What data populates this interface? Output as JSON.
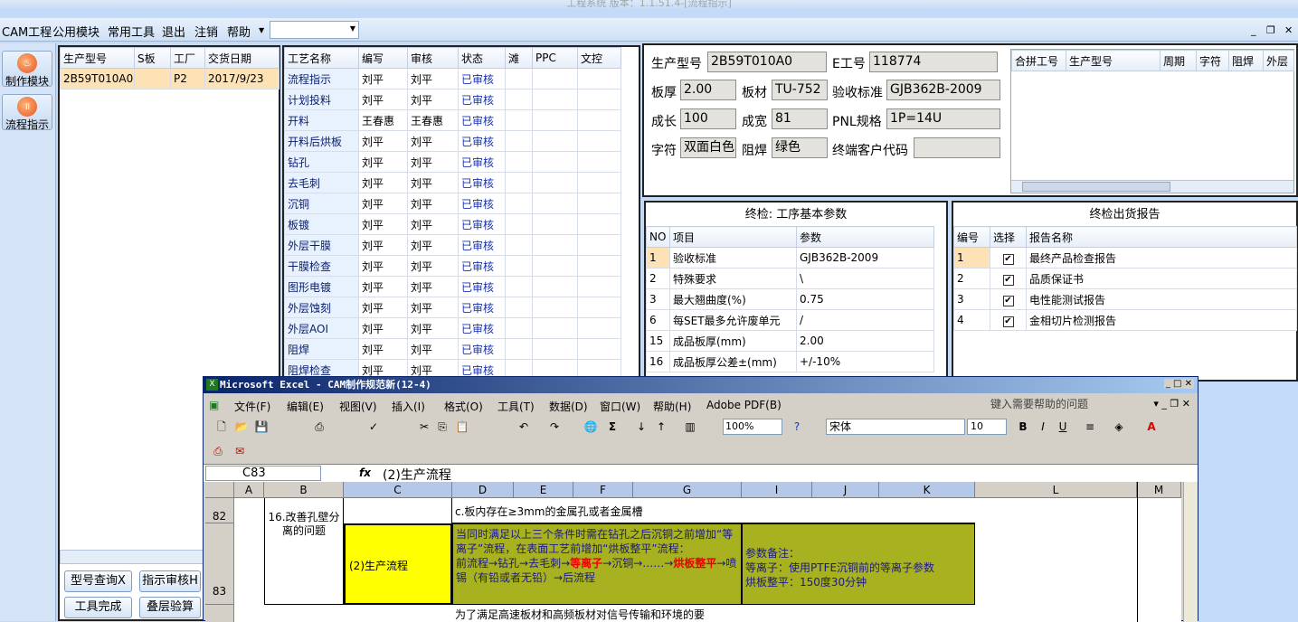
{
  "app": {
    "title": "工程系统 版本：1.1.51.4-[流程指示]"
  },
  "menu": [
    "CAM工程",
    "公用模块",
    "常用工具",
    "退出",
    "注销",
    "帮助"
  ],
  "nav": [
    {
      "label": "制作模块",
      "icon": "flame-icon"
    },
    {
      "label": "流程指示",
      "icon": "pause-icon"
    }
  ],
  "orders": {
    "headers": [
      "生产型号",
      "S板",
      "工厂",
      "交货日期"
    ],
    "rows": [
      [
        "2B59T010A0",
        "",
        "P2",
        "2017/9/23"
      ]
    ]
  },
  "process": {
    "headers": [
      "工艺名称",
      "编写",
      "审核",
      "状态",
      "滩",
      "PPC",
      "文控"
    ],
    "rows": [
      [
        "流程指示",
        "刘平",
        "刘平",
        "已审核"
      ],
      [
        "计划投料",
        "刘平",
        "刘平",
        "已审核"
      ],
      [
        "开料",
        "王春惠",
        "王春惠",
        "已审核"
      ],
      [
        "开料后烘板",
        "刘平",
        "刘平",
        "已审核"
      ],
      [
        "钻孔",
        "刘平",
        "刘平",
        "已审核"
      ],
      [
        "去毛刺",
        "刘平",
        "刘平",
        "已审核"
      ],
      [
        "沉铜",
        "刘平",
        "刘平",
        "已审核"
      ],
      [
        "板镀",
        "刘平",
        "刘平",
        "已审核"
      ],
      [
        "外层干膜",
        "刘平",
        "刘平",
        "已审核"
      ],
      [
        "干膜检查",
        "刘平",
        "刘平",
        "已审核"
      ],
      [
        "图形电镀",
        "刘平",
        "刘平",
        "已审核"
      ],
      [
        "外层蚀刻",
        "刘平",
        "刘平",
        "已审核"
      ],
      [
        "外层AOI",
        "刘平",
        "刘平",
        "已审核"
      ],
      [
        "阻焊",
        "刘平",
        "刘平",
        "已审核"
      ],
      [
        "阻焊检查",
        "刘平",
        "刘平",
        "已审核"
      ]
    ]
  },
  "info": {
    "l_model": "生产型号",
    "model": "2B59T010A0",
    "l_eno": "E工号",
    "eno": "118774",
    "l_thick": "板厚",
    "thick": "2.00",
    "l_mat": "板材",
    "mat": "TU-752",
    "l_std": "验收标准",
    "std": "GJB362B-2009",
    "l_len": "成长",
    "len": "100",
    "l_wid": "成宽",
    "wid": "81",
    "l_pnl": "PNL规格",
    "pnl": "1P=14U",
    "l_char": "字符",
    "char": "双面白色",
    "l_mask": "阻焊",
    "mask": "绿色",
    "l_cust": "终端客户代码",
    "cust": ""
  },
  "combine": {
    "headers": [
      "合拼工号",
      "生产型号",
      "周期",
      "字符",
      "阻焊",
      "外层"
    ]
  },
  "finalparams": {
    "title": "终检: 工序基本参数",
    "headers": [
      "NO",
      "项目",
      "参数"
    ],
    "rows": [
      [
        "1",
        "验收标准",
        "GJB362B-2009"
      ],
      [
        "2",
        "特殊要求",
        "\\"
      ],
      [
        "3",
        "最大翘曲度(%)",
        "0.75"
      ],
      [
        "6",
        "每SET最多允许废单元",
        "/"
      ],
      [
        "15",
        "成品板厚(mm)",
        "2.00"
      ],
      [
        "16",
        "成品板厚公差±(mm)",
        "+/-10%"
      ]
    ]
  },
  "report": {
    "title": "终检出货报告",
    "headers": [
      "编号",
      "选择",
      "报告名称"
    ],
    "rows": [
      [
        "1",
        "✔",
        "最终产品检查报告"
      ],
      [
        "2",
        "✔",
        "品质保证书"
      ],
      [
        "3",
        "✔",
        "电性能测试报告"
      ],
      [
        "4",
        "✔",
        "金相切片检测报告"
      ]
    ]
  },
  "buttons": {
    "query": "型号查询X",
    "review": "指示审核H",
    "done": "工具完成",
    "stack": "叠层验算"
  },
  "excel": {
    "title": "Microsoft Excel - CAM制作规范新(12-4)",
    "menus": [
      "文件(F)",
      "编辑(E)",
      "视图(V)",
      "插入(I)",
      "格式(O)",
      "工具(T)",
      "数据(D)",
      "窗口(W)",
      "帮助(H)",
      "Adobe PDF(B)"
    ],
    "help": "键入需要帮助的问题",
    "zoom": "100%",
    "font": "宋体",
    "size": "10",
    "namebox": "C83",
    "formula": "(2)生产流程",
    "cols": [
      "A",
      "B",
      "C",
      "D",
      "E",
      "F",
      "G",
      "I",
      "J",
      "K",
      "L",
      "M"
    ],
    "r82": "82",
    "r83": "83",
    "b82": "16.改善孔壁分离的问题",
    "d82": "c.板内存在≥3mm的金属孔或者金属槽",
    "c83": "(2)生产流程",
    "d83a": "当同时满足以上三个条件时需在钻孔之后沉铜之前增加“等离子”流程，在表面工艺前增加“烘板整平”流程：",
    "d83b": "前流程→钻孔→去毛刺→",
    "d83c": "等离子",
    "d83d": "→沉铜→……→",
    "d83e": "烘板整平",
    "d83f": "→喷锡（有铅或者无铅）→后流程",
    "i83a": "参数备注：",
    "i83b": "等离子：使用PTFE沉铜前的等离子参数",
    "i83c": "烘板整平：150度30分钟",
    "d84": "为了满足高速板材和高频板材对信号传输和环境的要"
  }
}
